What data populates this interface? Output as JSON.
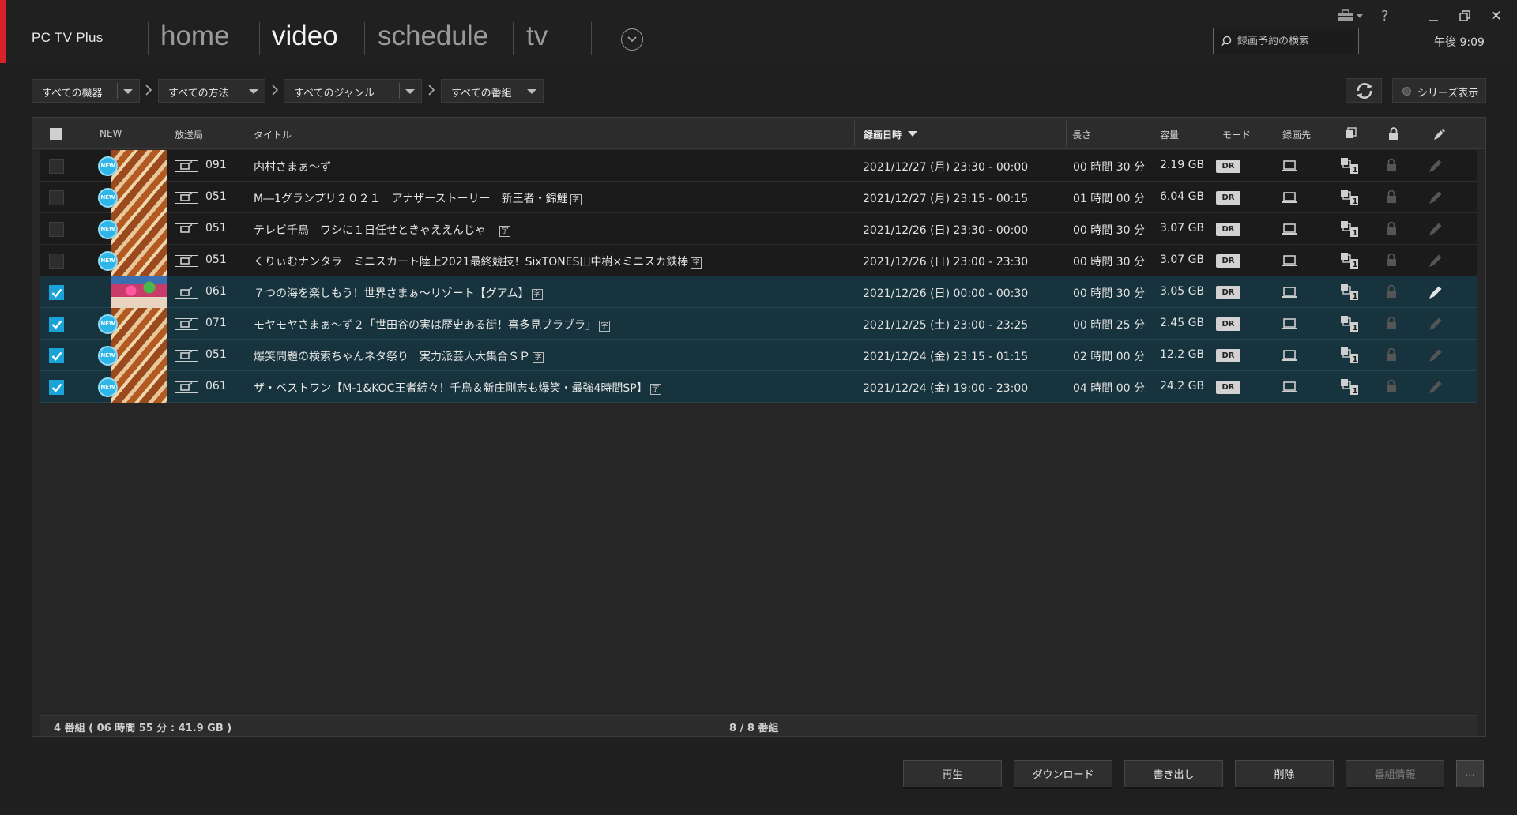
{
  "app": {
    "title": "PC TV Plus",
    "accent_color": "#d7222a",
    "clock": "午後 9:09"
  },
  "nav": {
    "tabs": [
      {
        "label": "home",
        "active": false
      },
      {
        "label": "video",
        "active": true
      },
      {
        "label": "schedule",
        "active": false
      },
      {
        "label": "tv",
        "active": false
      }
    ]
  },
  "search": {
    "placeholder": "録画予約の検索",
    "value": ""
  },
  "filters": [
    {
      "label": "すべての機器"
    },
    {
      "label": "すべての方法"
    },
    {
      "label": "すべてのジャンル"
    },
    {
      "label": "すべての番組"
    }
  ],
  "series_toggle": {
    "label": "シリーズ表示"
  },
  "table": {
    "headers": {
      "new": "NEW",
      "station": "放送局",
      "title": "タイトル",
      "date": "録画日時",
      "duration": "長さ",
      "size": "容量",
      "mode": "モード",
      "destination": "録画先"
    },
    "rows": [
      {
        "checked": false,
        "new": true,
        "thumb": "pattern",
        "channel": "091",
        "title": "内村さまぁ～ず",
        "subtitle_mark": false,
        "date": "2021/12/27 (月) 23:30 - 00:00",
        "duration": "00 時間 30 分",
        "size": "2.19 GB",
        "mode": "DR"
      },
      {
        "checked": false,
        "new": true,
        "thumb": "pattern",
        "channel": "051",
        "title": "M―1グランプリ２０２１　アナザーストーリー　新王者・錦鯉",
        "subtitle_mark": true,
        "date": "2021/12/27 (月) 23:15 - 00:15",
        "duration": "01 時間 00 分",
        "size": "6.04 GB",
        "mode": "DR"
      },
      {
        "checked": false,
        "new": true,
        "thumb": "pattern",
        "channel": "051",
        "title": "テレビ千鳥　ワシに１日任せときゃええんじゃ　",
        "subtitle_mark": true,
        "date": "2021/12/26 (日) 23:30 - 00:00",
        "duration": "00 時間 30 分",
        "size": "3.07 GB",
        "mode": "DR"
      },
      {
        "checked": false,
        "new": true,
        "thumb": "pattern",
        "channel": "051",
        "title": "くりぃむナンタラ　ミニスカート陸上2021最終競技！SixTONES田中樹×ミニスカ鉄棒",
        "subtitle_mark": true,
        "date": "2021/12/26 (日) 23:00 - 23:30",
        "duration": "00 時間 30 分",
        "size": "3.07 GB",
        "mode": "DR"
      },
      {
        "checked": true,
        "new": false,
        "thumb": "photo",
        "channel": "061",
        "title": "７つの海を楽しもう！世界さまぁ～リゾート【グアム】",
        "subtitle_mark": true,
        "date": "2021/12/26 (日) 00:00 - 00:30",
        "duration": "00 時間 30 分",
        "size": "3.05 GB",
        "mode": "DR"
      },
      {
        "checked": true,
        "new": true,
        "thumb": "pattern",
        "channel": "071",
        "title": "モヤモヤさまぁ～ず２「世田谷の実は歴史ある街！喜多見ブラブラ」",
        "subtitle_mark": true,
        "date": "2021/12/25 (土) 23:00 - 23:25",
        "duration": "00 時間 25 分",
        "size": "2.45 GB",
        "mode": "DR"
      },
      {
        "checked": true,
        "new": true,
        "thumb": "pattern",
        "channel": "051",
        "title": "爆笑問題の検索ちゃんネタ祭り　実力派芸人大集合ＳＰ",
        "subtitle_mark": true,
        "date": "2021/12/24 (金) 23:15 - 01:15",
        "duration": "02 時間 00 分",
        "size": "12.2 GB",
        "mode": "DR"
      },
      {
        "checked": true,
        "new": true,
        "thumb": "pattern",
        "channel": "061",
        "title": "ザ・ベストワン【M-1&KOC王者続々！千鳥＆新庄剛志も爆笑・最強4時間SP】",
        "subtitle_mark": true,
        "date": "2021/12/24 (金) 19:00 - 23:00",
        "duration": "04 時間 00 分",
        "size": "24.2 GB",
        "mode": "DR"
      }
    ],
    "summary_selected": "4 番組 ( 06 時間 55 分 : 41.9 GB )",
    "summary_count": "8 / 8 番組"
  },
  "badges": {
    "new": "NEW",
    "subtitle": "字"
  },
  "actions": [
    {
      "label": "再生",
      "enabled": true
    },
    {
      "label": "ダウンロード",
      "enabled": true
    },
    {
      "label": "書き出し",
      "enabled": true
    },
    {
      "label": "削除",
      "enabled": true
    },
    {
      "label": "番組情報",
      "enabled": false
    }
  ],
  "more_label": "···"
}
